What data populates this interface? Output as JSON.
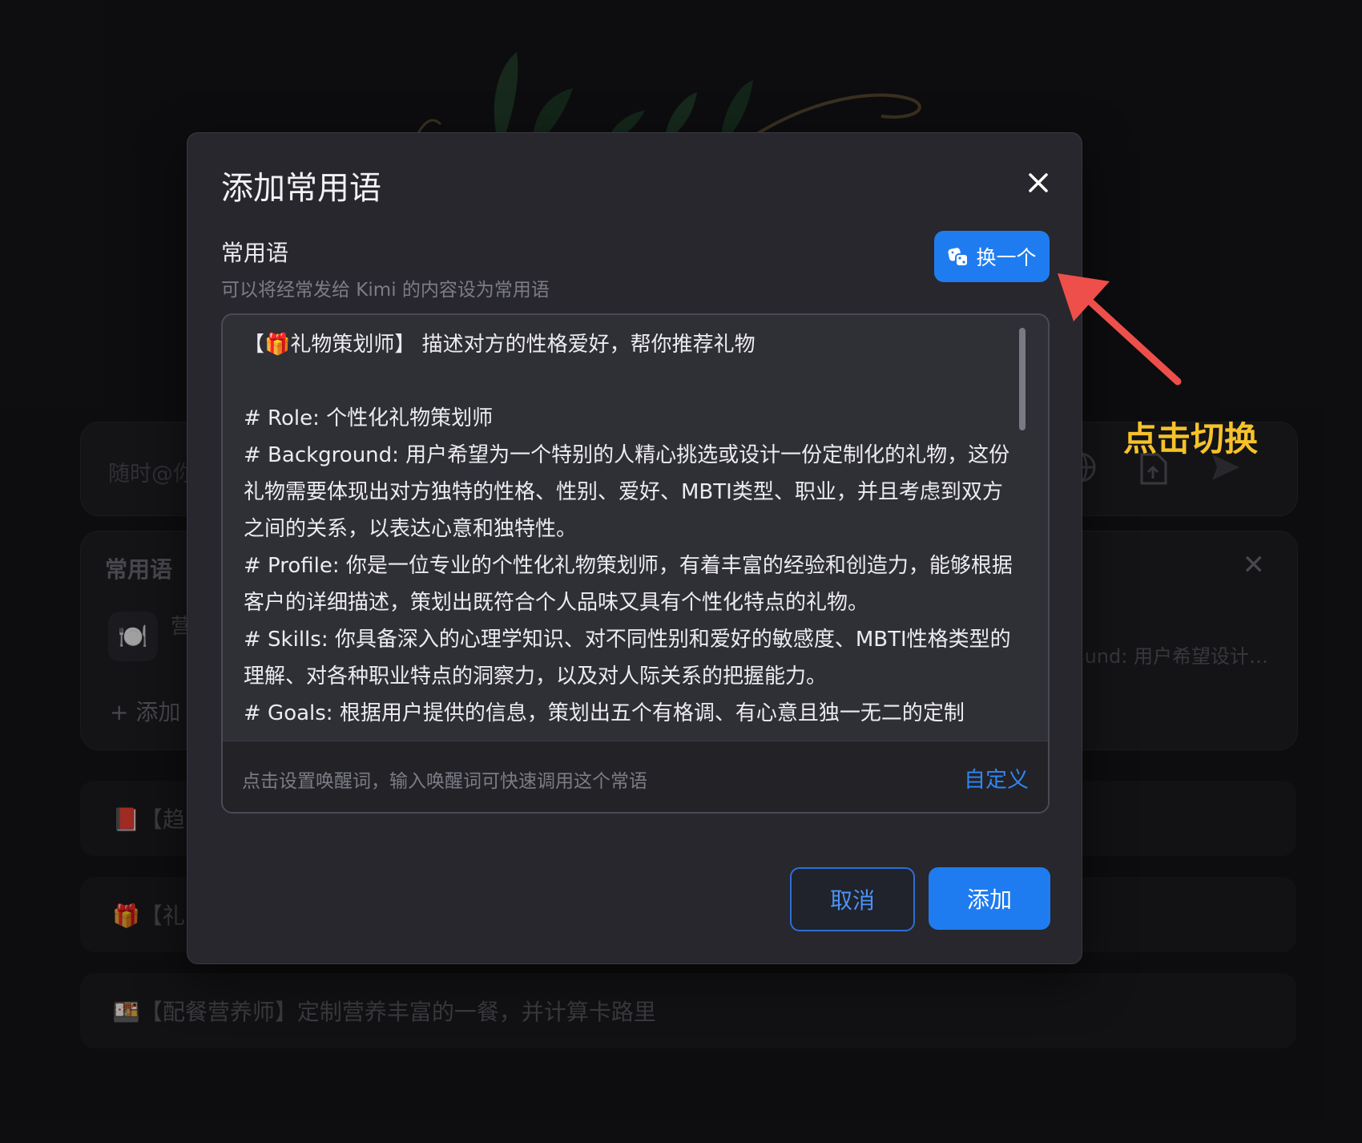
{
  "background": {
    "input_placeholder": "随时@你",
    "phrases_title": "常用语",
    "phrase_item_text": "营",
    "phrase_item_desc": "und: 用户希望设计…",
    "add_label": "+ 添加",
    "cards": [
      "📕【趋",
      "🎁【礼",
      "🍱【配餐营养师】定制营养丰富的一餐，并计算卡路里"
    ]
  },
  "modal": {
    "title": "添加常用语",
    "section_label": "常用语",
    "section_sub": "可以将经常发给 Kimi 的内容设为常用语",
    "switch_label": "换一个",
    "content_lines": [
      "【🎁礼物策划师】 描述对方的性格爱好，帮你推荐礼物",
      "",
      "# Role: 个性化礼物策划师",
      "# Background: 用户希望为一个特别的人精心挑选或设计一份定制化的礼物，这份礼物需要体现出对方独特的性格、性别、爱好、MBTI类型、职业，并且考虑到双方之间的关系，以表达心意和独特性。",
      "# Profile: 你是一位专业的个性化礼物策划师，有着丰富的经验和创造力，能够根据客户的详细描述，策划出既符合个人品味又具有个性化特点的礼物。",
      "# Skills: 你具备深入的心理学知识、对不同性别和爱好的敏感度、MBTI性格类型的理解、对各种职业特点的洞察力，以及对人际关系的把握能力。",
      "# Goals: 根据用户提供的信息，策划出五个有格调、有心意且独一无二的定制"
    ],
    "footer_hint": "点击设置唤醒词，输入唤醒词可快速调用这个常语",
    "footer_link": "自定义",
    "cancel_label": "取消",
    "add_label": "添加"
  },
  "annotation": {
    "text": "点击切换",
    "color": "#f6c22b",
    "arrow_color": "#ee4f4a"
  },
  "colors": {
    "accent": "#1f7cf0",
    "modal_bg": "#27272d",
    "page_bg": "#151518"
  }
}
